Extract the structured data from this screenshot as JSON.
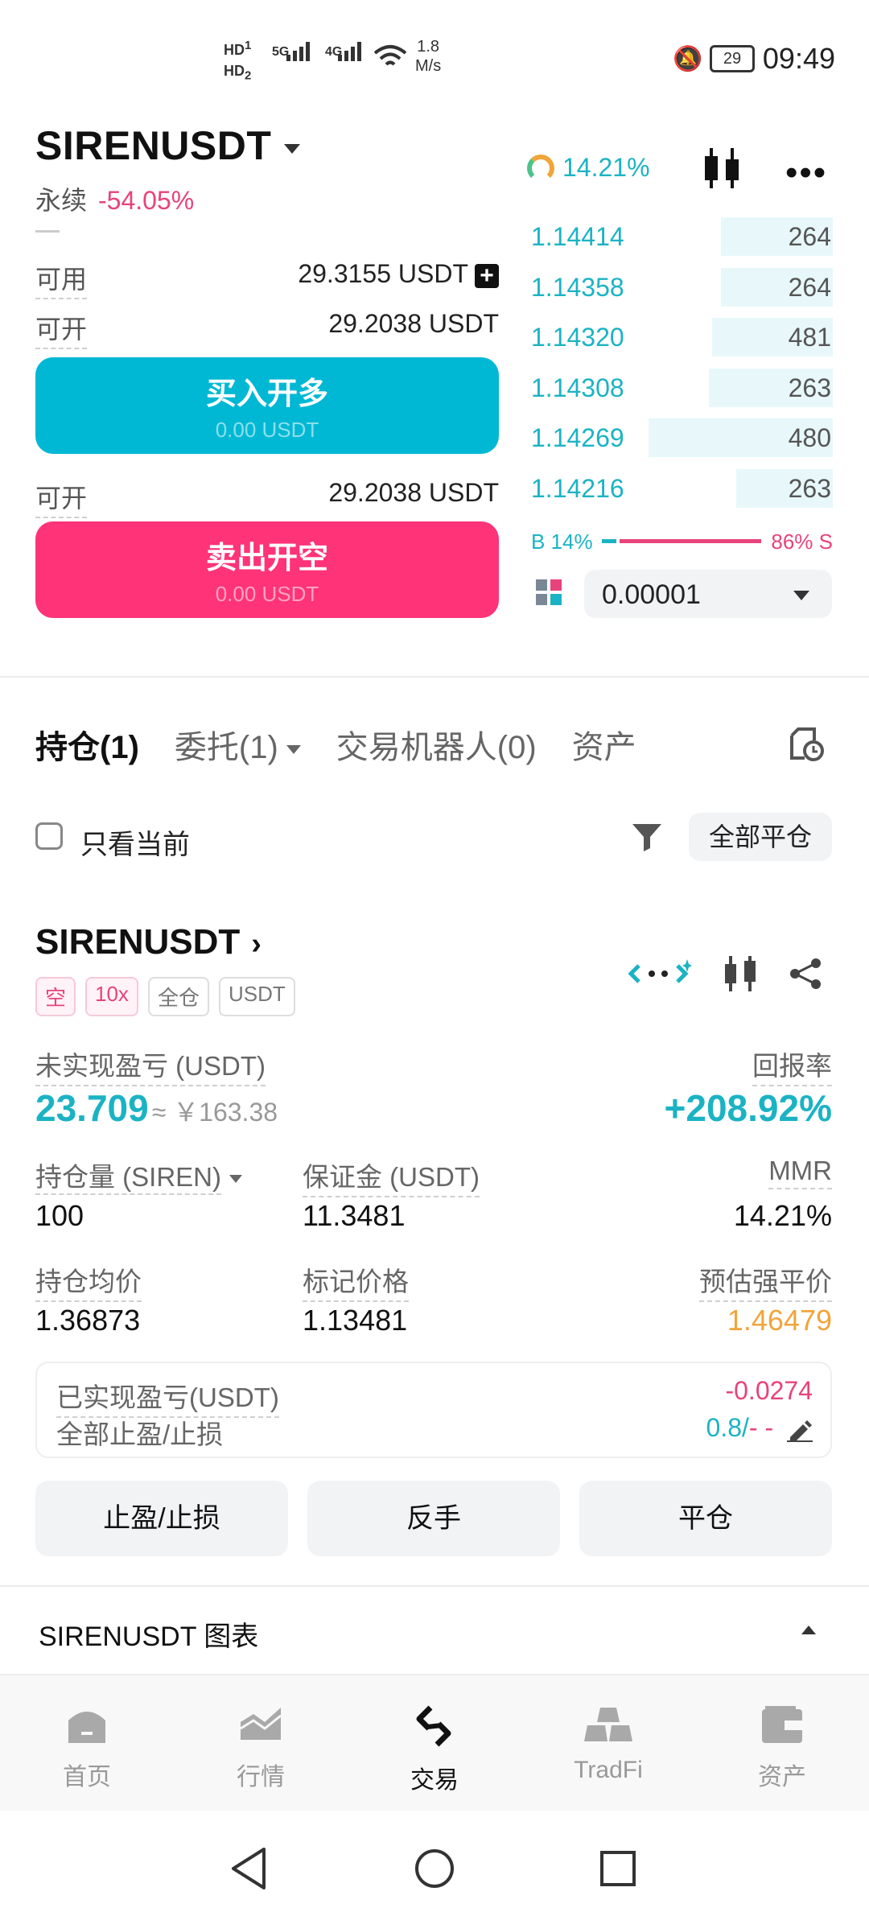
{
  "status_bar": {
    "hd_top": "HD",
    "hd_bottom": "HD",
    "hd_top_sub": "1",
    "hd_bottom_sub": "2",
    "sig_5g": "5G",
    "sig_4g": "4G",
    "speed": "1.8",
    "speed_unit": "M/s",
    "battery": "29",
    "time": "09:49"
  },
  "header": {
    "symbol": "SIRENUSDT",
    "contract_type": "永续",
    "change": "-54.05%",
    "mmr_indicator": "14.21%"
  },
  "trade_panel": {
    "available_label": "可用",
    "available_value": "29.3155 USDT",
    "open_label_1": "可开",
    "open_value_1": "29.2038 USDT",
    "buy_label": "买入开多",
    "buy_sub": "0.00 USDT",
    "open_label_2": "可开",
    "open_value_2": "29.2038 USDT",
    "sell_label": "卖出开空",
    "sell_sub": "0.00 USDT"
  },
  "orderbook": {
    "rows": [
      {
        "price": "1.14414",
        "qty": "264",
        "depth": 0.37
      },
      {
        "price": "1.14358",
        "qty": "264",
        "depth": 0.37
      },
      {
        "price": "1.14320",
        "qty": "481",
        "depth": 0.4
      },
      {
        "price": "1.14308",
        "qty": "263",
        "depth": 0.41
      },
      {
        "price": "1.14269",
        "qty": "480",
        "depth": 0.61
      },
      {
        "price": "1.14216",
        "qty": "263",
        "depth": 0.32
      }
    ],
    "buy_ratio": "B 14%",
    "sell_ratio": "86% S",
    "tick_size": "0.00001"
  },
  "tabs": {
    "positions": "持仓(1)",
    "orders": "委托(1)",
    "bots": "交易机器人(0)",
    "assets": "资产"
  },
  "filters": {
    "only_current": "只看当前",
    "close_all": "全部平仓"
  },
  "position": {
    "symbol": "SIRENUSDT",
    "tag_side": "空",
    "tag_leverage": "10x",
    "tag_margin": "全仓",
    "tag_asset": "USDT",
    "unrealized_label": "未实现盈亏 (USDT)",
    "unrealized_value": "23.709",
    "unrealized_cny": "≈ ￥163.38",
    "roi_label": "回报率",
    "roi_value": "+208.92%",
    "size_label": "持仓量 (SIREN)",
    "size_value": "100",
    "margin_label": "保证金 (USDT)",
    "margin_value": "11.3481",
    "mmr_label": "MMR",
    "mmr_value": "14.21%",
    "entry_label": "持仓均价",
    "entry_value": "1.36873",
    "mark_label": "标记价格",
    "mark_value": "1.13481",
    "liq_label": "预估强平价",
    "liq_value": "1.46479",
    "realized_label": "已实现盈亏(USDT)",
    "realized_value": "-0.0274",
    "tpsl_label": "全部止盈/止损",
    "tpsl_value": "0.8/",
    "tpsl_dash": "- -",
    "btn_tpsl": "止盈/止损",
    "btn_reverse": "反手",
    "btn_close": "平仓"
  },
  "chart_section": {
    "label": "SIRENUSDT 图表"
  },
  "bottom_nav": {
    "home": "首页",
    "market": "行情",
    "trade": "交易",
    "tradfi": "TradFi",
    "assets": "资产"
  },
  "colors": {
    "accent_cyan": "#1bb3c4",
    "buy_btn": "#00b8d4",
    "sell_btn": "#ff3377",
    "pink": "#e8437a",
    "orange": "#f1a53a"
  }
}
